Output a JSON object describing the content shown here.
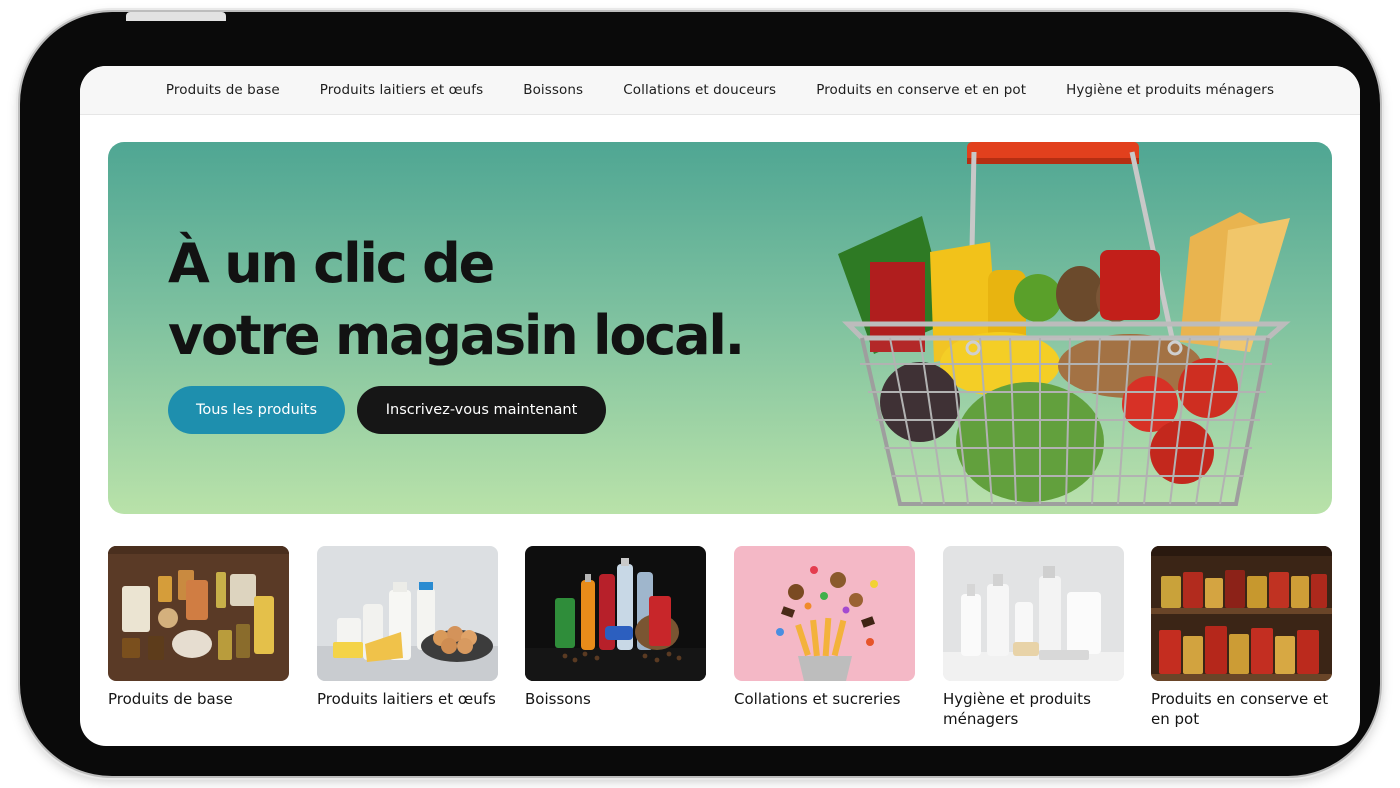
{
  "nav": {
    "items": [
      "Produits de base",
      "Produits laitiers et œufs",
      "Boissons",
      "Collations et douceurs",
      "Produits en conserve et en pot",
      "Hygiène et produits ménagers"
    ]
  },
  "hero": {
    "title_line1": "À un clic de",
    "title_line2": "votre magasin local.",
    "primary_button": "Tous les produits",
    "secondary_button": "Inscrivez-vous maintenant"
  },
  "categories": [
    {
      "label": "Produits de base",
      "image": "pantry-staples-image"
    },
    {
      "label": "Produits laitiers et œufs",
      "image": "dairy-eggs-image"
    },
    {
      "label": "Boissons",
      "image": "beverages-image"
    },
    {
      "label": "Collations et sucreries",
      "image": "snacks-sweets-image"
    },
    {
      "label": "Hygiène et produits ménagers",
      "image": "hygiene-household-image"
    },
    {
      "label": "Produits en conserve et en pot",
      "image": "canned-jarred-image"
    }
  ],
  "colors": {
    "primary_button": "#1e8fae",
    "dark_button": "#161616",
    "hero_top": "#4fa693",
    "hero_bottom": "#b9e2a9"
  }
}
